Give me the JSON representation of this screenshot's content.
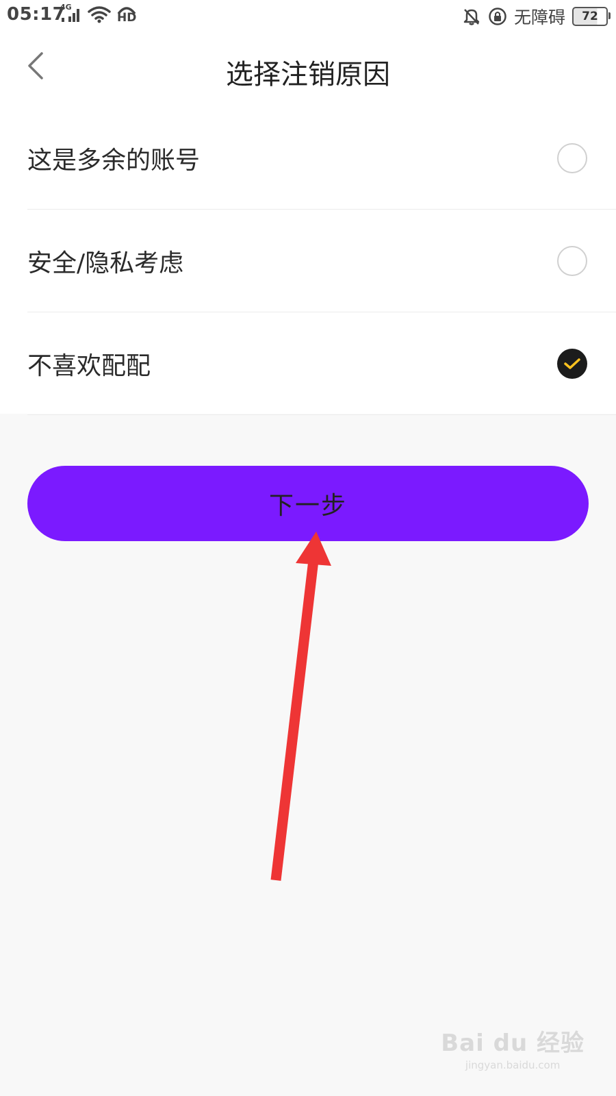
{
  "status_bar": {
    "time": "05:17",
    "network_label": "4G",
    "hd_label": "HD",
    "accessibility_label": "无障碍",
    "battery_level": "72"
  },
  "header": {
    "title": "选择注销原因"
  },
  "options": [
    {
      "label": "这是多余的账号",
      "selected": false
    },
    {
      "label": "安全/隐私考虑",
      "selected": false
    },
    {
      "label": "不喜欢配配",
      "selected": true
    }
  ],
  "next_button": {
    "label": "下一步"
  },
  "watermark": {
    "brand": "Bai du 经验",
    "url": "jingyan.baidu.com"
  },
  "colors": {
    "accent": "#7b1aff",
    "check_mark": "#ffc31f",
    "annotation_arrow": "#ee3535"
  }
}
